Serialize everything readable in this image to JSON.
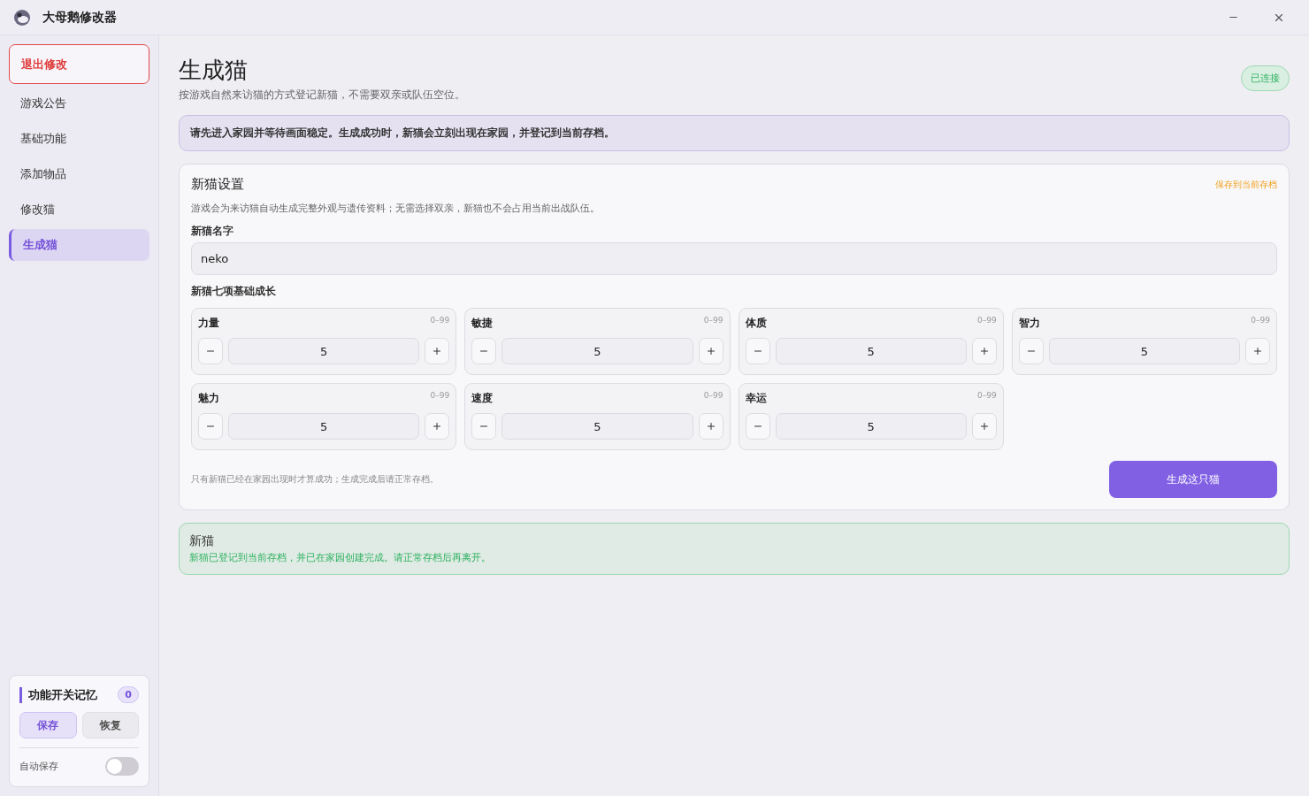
{
  "window": {
    "title": "大母鹅修改器"
  },
  "sidebar": {
    "items": [
      {
        "label": "退出修改",
        "kind": "exit",
        "selected": false
      },
      {
        "label": "游戏公告",
        "kind": "nav",
        "selected": false
      },
      {
        "label": "基础功能",
        "kind": "nav",
        "selected": false
      },
      {
        "label": "添加物品",
        "kind": "nav",
        "selected": false
      },
      {
        "label": "修改猫",
        "kind": "nav",
        "selected": false
      },
      {
        "label": "生成猫",
        "kind": "nav",
        "selected": true
      }
    ],
    "memory": {
      "title": "功能开关记忆",
      "count": "0",
      "save": "保存",
      "restore": "恢复",
      "auto_save_label": "自动保存",
      "auto_save_on": false
    }
  },
  "page": {
    "title": "生成猫",
    "subtitle": "按游戏自然来访猫的方式登记新猫，不需要双亲或队伍空位。",
    "status": "已连接",
    "notice": "请先进入家园并等待画面稳定。生成成功时，新猫会立刻出现在家园，并登记到当前存档。"
  },
  "settings": {
    "title": "新猫设置",
    "tag": "保存到当前存档",
    "description": "游戏会为来访猫自动生成完整外观与遗传资料；无需选择双亲，新猫也不会占用当前出战队伍。",
    "name_label": "新猫名字",
    "name_value": "neko",
    "stats_label": "新猫七项基础成长",
    "stats": [
      {
        "label": "力量",
        "range": "0–99",
        "value": "5"
      },
      {
        "label": "敏捷",
        "range": "0–99",
        "value": "5"
      },
      {
        "label": "体质",
        "range": "0–99",
        "value": "5"
      },
      {
        "label": "智力",
        "range": "0–99",
        "value": "5"
      },
      {
        "label": "魅力",
        "range": "0–99",
        "value": "5"
      },
      {
        "label": "速度",
        "range": "0–99",
        "value": "5"
      },
      {
        "label": "幸运",
        "range": "0–99",
        "value": "5"
      }
    ],
    "footnote": "只有新猫已经在家园出现时才算成功；生成完成后请正常存档。",
    "button": "生成这只猫"
  },
  "result": {
    "title": "新猫",
    "message": "新猫已登记到当前存档，并已在家园创建完成。请正常存档后再离开。"
  }
}
